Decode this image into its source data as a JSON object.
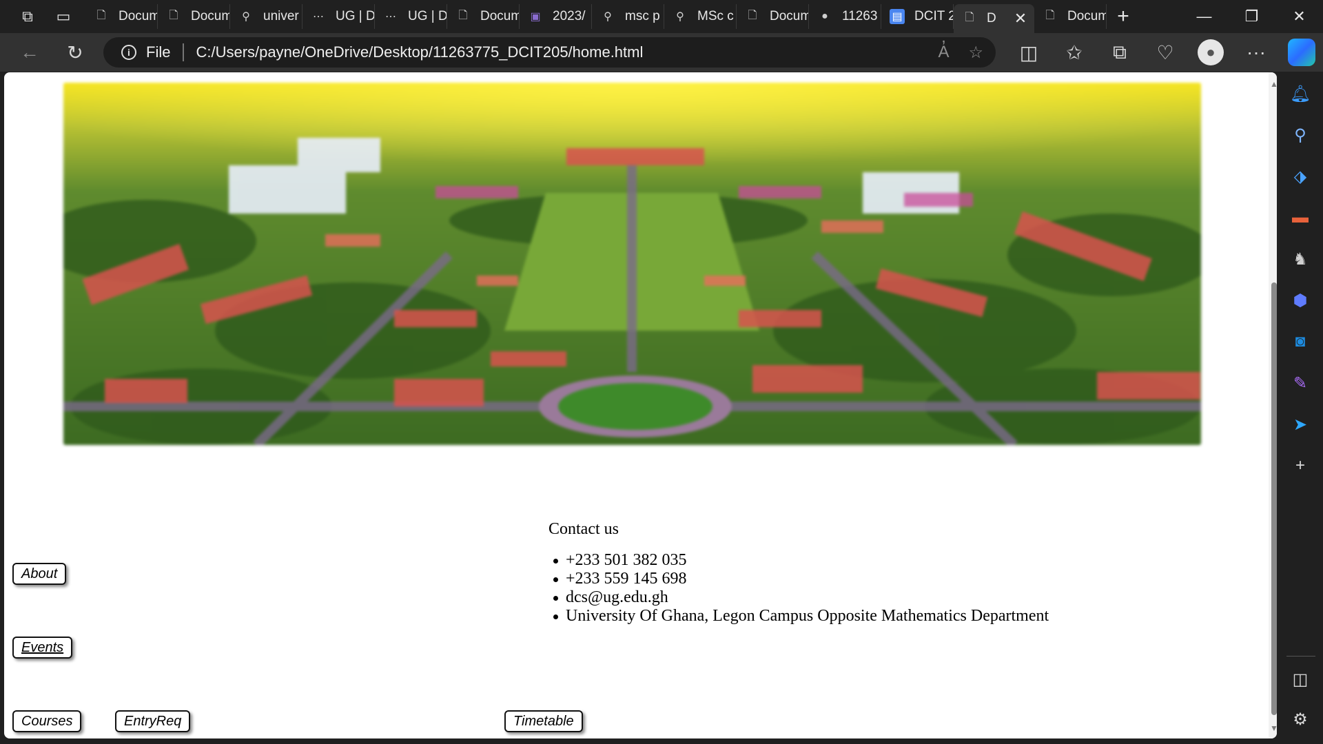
{
  "browser": {
    "tabs": [
      {
        "title": "Docum",
        "icon": "page-icon"
      },
      {
        "title": "Docum",
        "icon": "page-icon"
      },
      {
        "title": "univer",
        "icon": "search-icon"
      },
      {
        "title": "UG | D",
        "icon": "site-icon"
      },
      {
        "title": "UG | D",
        "icon": "site-icon"
      },
      {
        "title": "Docum",
        "icon": "page-icon"
      },
      {
        "title": "2023/",
        "icon": "crest-icon"
      },
      {
        "title": "msc p",
        "icon": "search-icon"
      },
      {
        "title": "MSc c",
        "icon": "search-icon"
      },
      {
        "title": "Docum",
        "icon": "page-icon"
      },
      {
        "title": "11263",
        "icon": "github-icon"
      },
      {
        "title": "DCIT 2",
        "icon": "docs-icon"
      },
      {
        "title": "D",
        "icon": "page-icon",
        "active": true
      },
      {
        "title": "Docum",
        "icon": "page-icon"
      }
    ],
    "address": {
      "scheme": "File",
      "url": "C:/Users/payne/OneDrive/Desktop/11263775_DCIT205/home.html"
    }
  },
  "page": {
    "hero_alt": "Aerial view of the University of Ghana campus",
    "contact": {
      "title": "Contact us",
      "items": [
        "+233 501 382 035",
        "+233 559 145 698",
        "dcs@ug.edu.gh",
        "University Of Ghana, Legon Campus Opposite Mathematics Department"
      ]
    },
    "nav": {
      "about": "About",
      "events": "Events",
      "courses": "Courses",
      "entryreq": "EntryReq",
      "timetable": "Timetable"
    }
  },
  "sidebar": {
    "items": [
      "bell-icon",
      "search-icon",
      "tag-icon",
      "briefcase-icon",
      "chess-icon",
      "m365-icon",
      "outlook-icon",
      "designer-icon",
      "send-icon",
      "add-icon"
    ]
  }
}
